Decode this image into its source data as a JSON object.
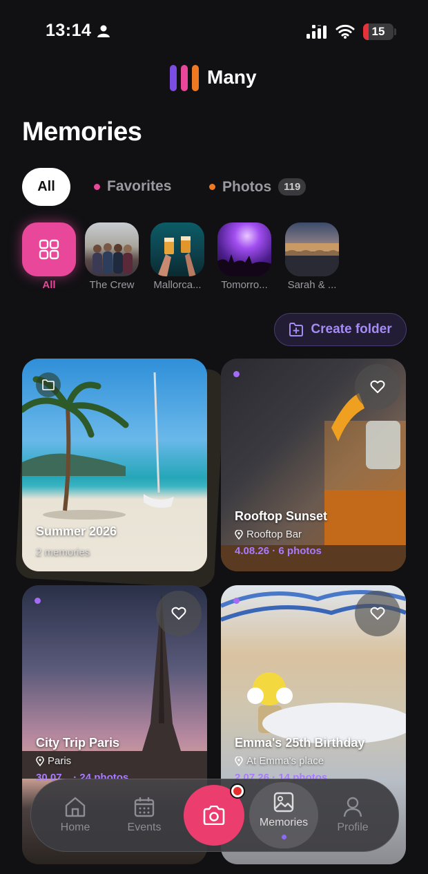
{
  "status_bar": {
    "time": "13:14",
    "battery": "15"
  },
  "brand": {
    "name": "Many",
    "colors": [
      "#7b4de0",
      "#e8479a",
      "#f07a22"
    ]
  },
  "page_title": "Memories",
  "filters": {
    "all": "All",
    "favorites": "Favorites",
    "photos": "Photos",
    "photos_count": "119",
    "favorites_color": "#e8479a",
    "photos_color": "#f07a22"
  },
  "folders": [
    {
      "label": "All",
      "icon": "grid-icon"
    },
    {
      "label": "The Crew"
    },
    {
      "label": "Mallorca..."
    },
    {
      "label": "Tomorro..."
    },
    {
      "label": "Sarah & ..."
    }
  ],
  "create_folder_label": "Create folder",
  "cards": [
    {
      "title": "Summer 2026",
      "meta": "2 memories",
      "type": "folder"
    },
    {
      "title": "Rooftop Sunset",
      "location": "Rooftop Bar",
      "date": "4.08.26",
      "photos": "6 photos"
    },
    {
      "title": "City Trip Paris",
      "location": "Paris",
      "date": "30.07...",
      "photos": "24 photos"
    },
    {
      "title": "Emma's 25th Birthday",
      "location": "At Emma's place",
      "date": "2.07.26",
      "photos": "14 photos"
    }
  ],
  "nav": {
    "home": "Home",
    "events": "Events",
    "memories": "Memories",
    "profile": "Profile",
    "active": "Memories"
  }
}
